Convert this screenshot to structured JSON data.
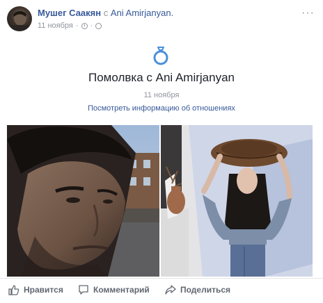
{
  "header": {
    "author": "Мушег Саакян",
    "connector": "с",
    "tagged": "Ani Amirjanyan.",
    "date": "11 ноября",
    "more_label": "···"
  },
  "event": {
    "title": "Помолвка с Ani Amirjanyan",
    "date": "11 ноября",
    "link": "Посмотреть информацию об отношениях"
  },
  "actions": {
    "like": "Нравится",
    "comment": "Комментарий",
    "share": "Поделиться"
  },
  "colors": {
    "link_blue": "#365899",
    "muted": "#90949c",
    "ring_blue": "#4a90d9"
  }
}
